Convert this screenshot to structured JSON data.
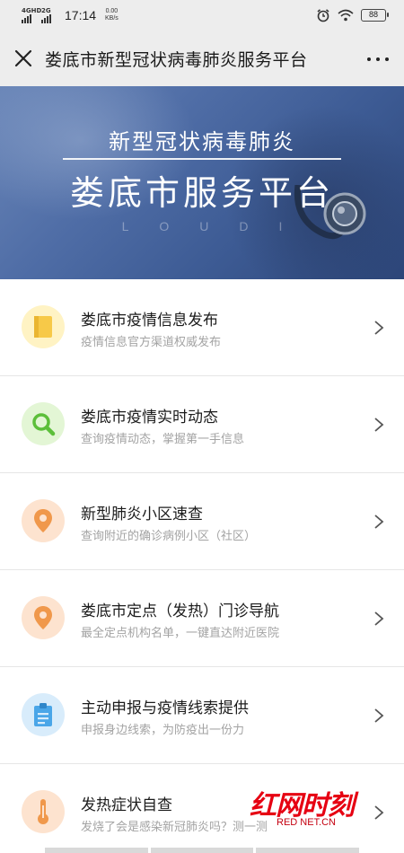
{
  "status_bar": {
    "signal_1": "4GHD",
    "signal_2": "2G",
    "time": "17:14",
    "speed_value": "0.00",
    "speed_unit": "KB/s",
    "battery": "88"
  },
  "header": {
    "title": "娄底市新型冠状病毒肺炎服务平台"
  },
  "banner": {
    "subtitle": "新型冠状病毒肺炎",
    "title": "娄底市服务平台",
    "latin": "LOUDI"
  },
  "items": [
    {
      "title": "娄底市疫情信息发布",
      "desc": "疫情信息官方渠道权威发布",
      "icon": "notebook-icon",
      "bg": "#fff3c4",
      "fg": "#f7c948"
    },
    {
      "title": "娄底市疫情实时动态",
      "desc": "查询疫情动态，掌握第一手信息",
      "icon": "search-icon",
      "bg": "#e3f6d5",
      "fg": "#5cbf3a"
    },
    {
      "title": "新型肺炎小区速查",
      "desc": "查询附近的确诊病例小区（社区）",
      "icon": "location-pin-icon",
      "bg": "#fde3cf",
      "fg": "#f0984b"
    },
    {
      "title": "娄底市定点（发热）门诊导航",
      "desc": "最全定点机构名单，一键直达附近医院",
      "icon": "location-pin-icon",
      "bg": "#fde3cf",
      "fg": "#f0984b"
    },
    {
      "title": "主动申报与疫情线索提供",
      "desc": "申报身边线索，为防疫出一份力",
      "icon": "clipboard-icon",
      "bg": "#d8ecfb",
      "fg": "#4aa6e8"
    },
    {
      "title": "发热症状自查",
      "desc": "发烧了会是感染新冠肺炎吗？测一测",
      "icon": "thermometer-icon",
      "bg": "#fde3cf",
      "fg": "#f0984b"
    }
  ],
  "watermark": {
    "logo": "红网时刻",
    "url": "RED NET.CN"
  }
}
